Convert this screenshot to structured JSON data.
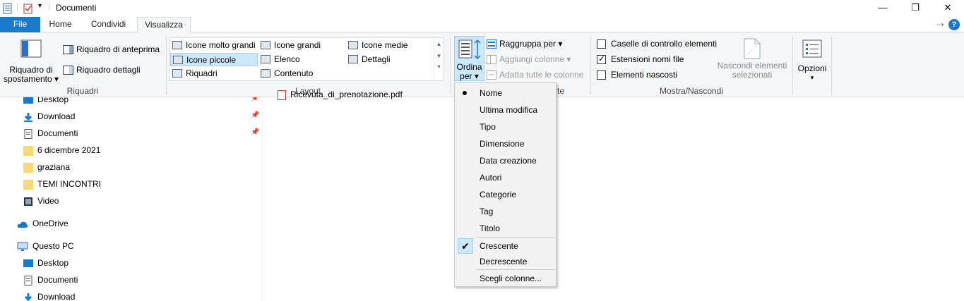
{
  "window": {
    "title": "Documenti",
    "minimize_glyph": "—",
    "maximize_glyph": "❐",
    "close_glyph": "✕"
  },
  "tabs": {
    "file": "File",
    "home": "Home",
    "condividi": "Condividi",
    "visualizza": "Visualizza",
    "pin_glyph": "⇢",
    "help_glyph": "?"
  },
  "ribbon": {
    "riquadri": {
      "riquadro_spostamento_1": "Riquadro di",
      "riquadro_spostamento_2": "spostamento ▾",
      "riquadro_anteprima": "Riquadro di anteprima",
      "riquadro_dettagli": "Riquadro dettagli",
      "label": "Riquadri"
    },
    "layout": {
      "items": [
        "Icone molto grandi",
        "Icone grandi",
        "Icone medie",
        "Icone piccole",
        "Elenco",
        "Dettagli",
        "Riquadri",
        "Contenuto"
      ],
      "label": "Layout"
    },
    "visualizzazione": {
      "ordina_1": "Ordina",
      "ordina_2": "per ▾",
      "raggruppa": "Raggruppa per ▾",
      "aggiungi_colonne": "Aggiungi colonne ▾",
      "adatta_colonne": "Adatta tutte le colonne",
      "label_partial": "te"
    },
    "mostra": {
      "caselle": "Caselle di controllo elementi",
      "estensioni": "Estensioni nomi file",
      "elementi_nascosti": "Elementi nascosti",
      "nascondi_1": "Nascondi elementi",
      "nascondi_2": "selezionati",
      "label": "Mostra/Nascondi"
    },
    "opzioni": {
      "label": "Opzioni",
      "arrow": "▾"
    }
  },
  "nav": {
    "quick": [
      "Desktop",
      "Download",
      "Documenti",
      "6 dicembre 2021",
      "graziana",
      "TEMI INCONTRI",
      "Video"
    ],
    "onedrive": "OneDrive",
    "questo_pc": "Questo PC",
    "pc_items": [
      "Desktop",
      "Documenti",
      "Download"
    ]
  },
  "files": {
    "first": "Ricevuta_di_prenotazione.pdf"
  },
  "sort_menu": {
    "items": [
      "Nome",
      "Ultima modifica",
      "Tipo",
      "Dimensione",
      "Data creazione",
      "Autori",
      "Categorie",
      "Tag",
      "Titolo"
    ],
    "crescente": "Crescente",
    "decrescente": "Decrescente",
    "scegli_colonne": "Scegli colonne..."
  }
}
